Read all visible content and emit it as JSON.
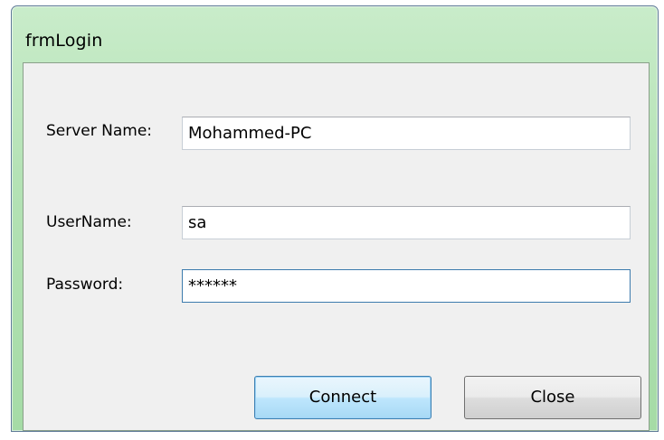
{
  "window": {
    "title": "frmLogin"
  },
  "form": {
    "server_name_label": "Server Name:",
    "server_name_value": "Mohammed-PC",
    "username_label": "UserName:",
    "username_value": "sa",
    "password_label": "Password:",
    "password_value": "******"
  },
  "buttons": {
    "connect_label": "Connect",
    "close_label": "Close"
  },
  "colors": {
    "frame": "#b4e2b5",
    "client_bg": "#f0f0f0",
    "focus_border": "#3d7bad"
  }
}
